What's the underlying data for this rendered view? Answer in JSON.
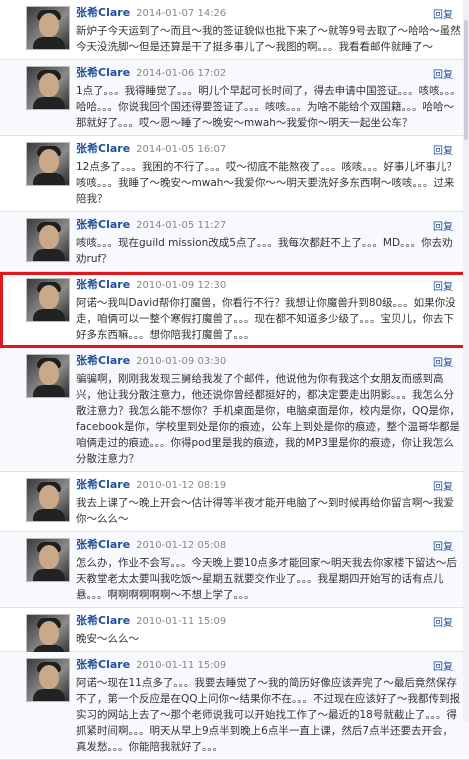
{
  "reply_label": "回复",
  "posts": [
    {
      "author": "张希Clare",
      "time": "2014-01-07 14:26",
      "content": "新炉子今天运到了～而且～我的签证貌似也批下来了～就等9号去取了～哈哈～虽然今天没洗脚～但是还算是干了挺多事儿了～我图的啊。。。我看看邮件就睡了～"
    },
    {
      "author": "张希Clare",
      "time": "2014-01-06 17:02",
      "content": "1点了。。。我得睡觉了。。。明儿个早起可长时间了，得去申请中国签证。。。咳咳。。。哈哈。。。你说我回个国还得要签证了。。。咳咳。。。为啥不能给个双国籍。。。哈哈～那就好了。。。哎～恩～睡了～晚安～mwah～我爱你～明天一起坐公车？"
    },
    {
      "author": "张希Clare",
      "time": "2014-01-05 16:07",
      "content": "12点多了。。。我困的不行了。。。哎～彻底不能熬夜了。。。咳咳。。。好事儿坏事儿？咳咳。。。我睡了～晚安～mwah～我爱你～～明天要洗好多东西啊～咳咳。。。过来陪我？"
    },
    {
      "author": "张希Clare",
      "time": "2014-01-05 11:27",
      "content": "咳咳。。。现在guild mission改成5点了。。。我每次都赶不上了。。。MD。。。你去劝劝ruf？"
    },
    {
      "author": "张希Clare",
      "time": "2010-01-09 12:30",
      "highlight": true,
      "content": "阿诺～我叫David帮你打魔兽，你看行不行？我想让你魔兽升到80级。。。如果你没走，咱俩可以一整个寒假打魔兽了。。。现在都不知道多少级了。。。宝贝儿，你去下好多东西嘛。。。想你陪我打魔兽了。。。"
    },
    {
      "author": "张希Clare",
      "time": "2010-01-09 03:30",
      "content": "骗骗啊，刚刚我发现三舅给我发了个邮件，他说他为你有我这个女朋友而感到高兴，他让我分散注意力，他还说你曾经都挺好的，都决定要走出阴影。。。我怎么分散注意力？我怎么能不想你？手机桌面是你，电脑桌面是你，校内是你，QQ是你，facebook是你，学校里到处是你的痕迹，公车上到处是你的痕迹，整个温哥华都是咱俩走过的痕迹。。。你得pod里是我的痕迹，我的MP3里是你的痕迹，你让我怎么分散注意力？"
    },
    {
      "author": "张希Clare",
      "time": "2010-01-12 08:19",
      "content": "我去上课了～晚上开会～估计得等半夜才能开电脑了～到时候再给你留言啊～我爱你～么么～"
    },
    {
      "author": "张希Clare",
      "time": "2010-01-12 05:08",
      "content": "怎么办，作业不会写。。。今天晚上要10点多才能回家～明天我去你家楼下留达～后天教堂老太太要叫我吃饭～星期五就要交作业了。。。我星期四开始写的话有点儿悬。。。啊啊啊啊啊啊～不想上学了。。。"
    },
    {
      "author": "张希Clare",
      "time": "2010-01-11 15:09",
      "content": "晚安～么么～"
    },
    {
      "author": "张希Clare",
      "time": "2010-01-11 15:09",
      "content": "阿诺～现在11点多了。。。我要去睡觉了～我的简历好像应该弄完了～最后竟然保存不了，第一个反应是在QQ上问你～结果你不在。。。不过现在应该好了～我都传到报实习的网站上去了～那个老师说我可以开始找工作了～最近的18号就截止了。。。得抓紧时间啊。。。明天从早上9点半到晚上6点半一直上课，然后7点半还要去开会，真发愁。。。你能陪我就好了。。。"
    }
  ]
}
